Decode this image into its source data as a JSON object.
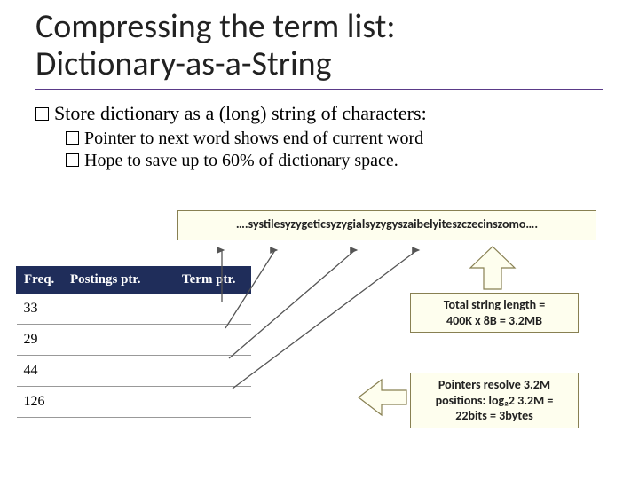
{
  "title_line1": "Compressing the term list:",
  "title_line2": "Dictionary-as-a-String",
  "bullets": {
    "main": "Store dictionary as a (long) string of characters:",
    "sub1": "Pointer to next word shows end of current word",
    "sub2": "Hope to save up to 60% of dictionary space."
  },
  "string_box": "….systilesyzygeticsyzygialsyzygyszaibelyiteszczecinszomo….",
  "table": {
    "headers": [
      "Freq.",
      "Postings ptr.",
      "Term ptr."
    ],
    "rows": [
      "33",
      "29",
      "44",
      "126"
    ]
  },
  "callouts": {
    "total_len_l1": "Total string length =",
    "total_len_l2": "400K x 8B = 3.2MB",
    "ptr_l1": "Pointers resolve 3.2M",
    "ptr_l2": "positions: log₂2 3.2M =",
    "ptr_l3": "22bits = 3bytes"
  },
  "chart_data": {
    "type": "table",
    "title": "Dictionary-as-a-String structure",
    "columns": [
      "Freq.",
      "Postings ptr.",
      "Term ptr."
    ],
    "rows": [
      {
        "Freq.": 33,
        "Postings ptr.": "",
        "Term ptr.": ""
      },
      {
        "Freq.": 29,
        "Postings ptr.": "",
        "Term ptr.": ""
      },
      {
        "Freq.": 44,
        "Postings ptr.": "",
        "Term ptr.": ""
      },
      {
        "Freq.": 126,
        "Postings ptr.": "",
        "Term ptr.": ""
      }
    ],
    "annotations": [
      "Total string length = 400K x 8B = 3.2MB",
      "Pointers resolve 3.2M positions: log2 3.2M = 22bits = 3bytes"
    ]
  }
}
